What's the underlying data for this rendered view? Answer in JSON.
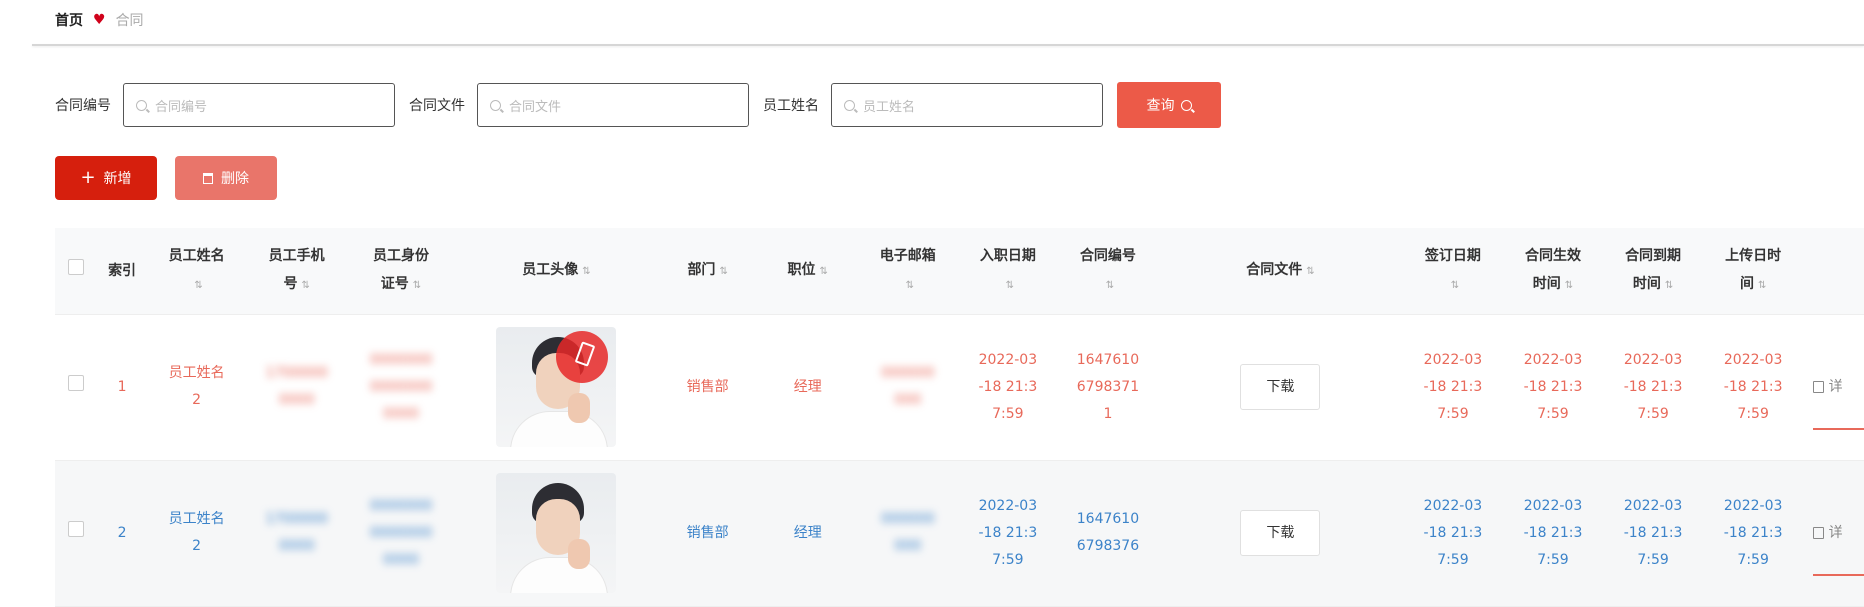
{
  "breadcrumb": {
    "home": "首页",
    "current": "合同"
  },
  "filters": [
    {
      "label": "合同编号",
      "placeholder": "合同编号"
    },
    {
      "label": "合同文件",
      "placeholder": "合同文件"
    },
    {
      "label": "员工姓名",
      "placeholder": "员工姓名"
    }
  ],
  "search_label": "查询",
  "actions": {
    "add_label": "新增",
    "delete_label": "删除"
  },
  "sort_glyph": "⇅",
  "table": {
    "headers": {
      "index": "索引",
      "name_1": "员工姓名",
      "name_2": "",
      "phone_1": "员工手机",
      "phone_2": "号",
      "idcard_1": "员工身份",
      "idcard_2": "证号",
      "avatar": "员工头像",
      "dept": "部门",
      "position": "职位",
      "email_1": "电子邮箱",
      "email_2": "",
      "hire_1": "入职日期",
      "hire_2": "",
      "contract_no_1": "合同编号",
      "contract_no_2": "",
      "contract_file": "合同文件",
      "sign_1": "签订日期",
      "sign_2": "",
      "effective_1": "合同生效",
      "effective_2": "时间",
      "expire_1": "合同到期",
      "expire_2": "时间",
      "upload_1": "上传日时",
      "upload_2": "间"
    },
    "rows": [
      {
        "index": "1",
        "name_1": "员工姓名",
        "name_2": "2",
        "phone_1": "1700000",
        "phone_2": "0000",
        "id_1": "0000000",
        "id_2": "0000000",
        "id_3": "0000",
        "dept": "销售部",
        "position": "经理",
        "email_1": "000000",
        "email_2": "000",
        "hire_1": "2022-03",
        "hire_2": "-18 21:3",
        "hire_3": "7:59",
        "cno_1": "1647610",
        "cno_2": "6798371",
        "cno_3": "1",
        "download": "下载",
        "sign_1": "2022-03",
        "sign_2": "-18 21:3",
        "sign_3": "7:59",
        "eff_1": "2022-03",
        "eff_2": "-18 21:3",
        "eff_3": "7:59",
        "exp_1": "2022-03",
        "exp_2": "-18 21:3",
        "exp_3": "7:59",
        "up_1": "2022-03",
        "up_2": "-18 21:3",
        "up_3": "7:59",
        "op": "详"
      },
      {
        "index": "2",
        "name_1": "员工姓名",
        "name_2": "2",
        "phone_1": "1700000",
        "phone_2": "0000",
        "id_1": "0000000",
        "id_2": "0000000",
        "id_3": "0000",
        "dept": "销售部",
        "position": "经理",
        "email_1": "000000",
        "email_2": "000",
        "hire_1": "2022-03",
        "hire_2": "-18 21:3",
        "hire_3": "7:59",
        "cno_1": "1647610",
        "cno_2": "6798376",
        "cno_3": "",
        "download": "下载",
        "sign_1": "2022-03",
        "sign_2": "-18 21:3",
        "sign_3": "7:59",
        "eff_1": "2022-03",
        "eff_2": "-18 21:3",
        "eff_3": "7:59",
        "exp_1": "2022-03",
        "exp_2": "-18 21:3",
        "exp_3": "7:59",
        "up_1": "2022-03",
        "up_2": "-18 21:3",
        "up_3": "7:59",
        "op": "详"
      }
    ]
  },
  "colors": {
    "primary_red": "#d61f0d",
    "search_red": "#ec5a48",
    "delete_red": "#e9756a",
    "row_red": "#e8695a",
    "row_blue": "#3c83c9"
  }
}
